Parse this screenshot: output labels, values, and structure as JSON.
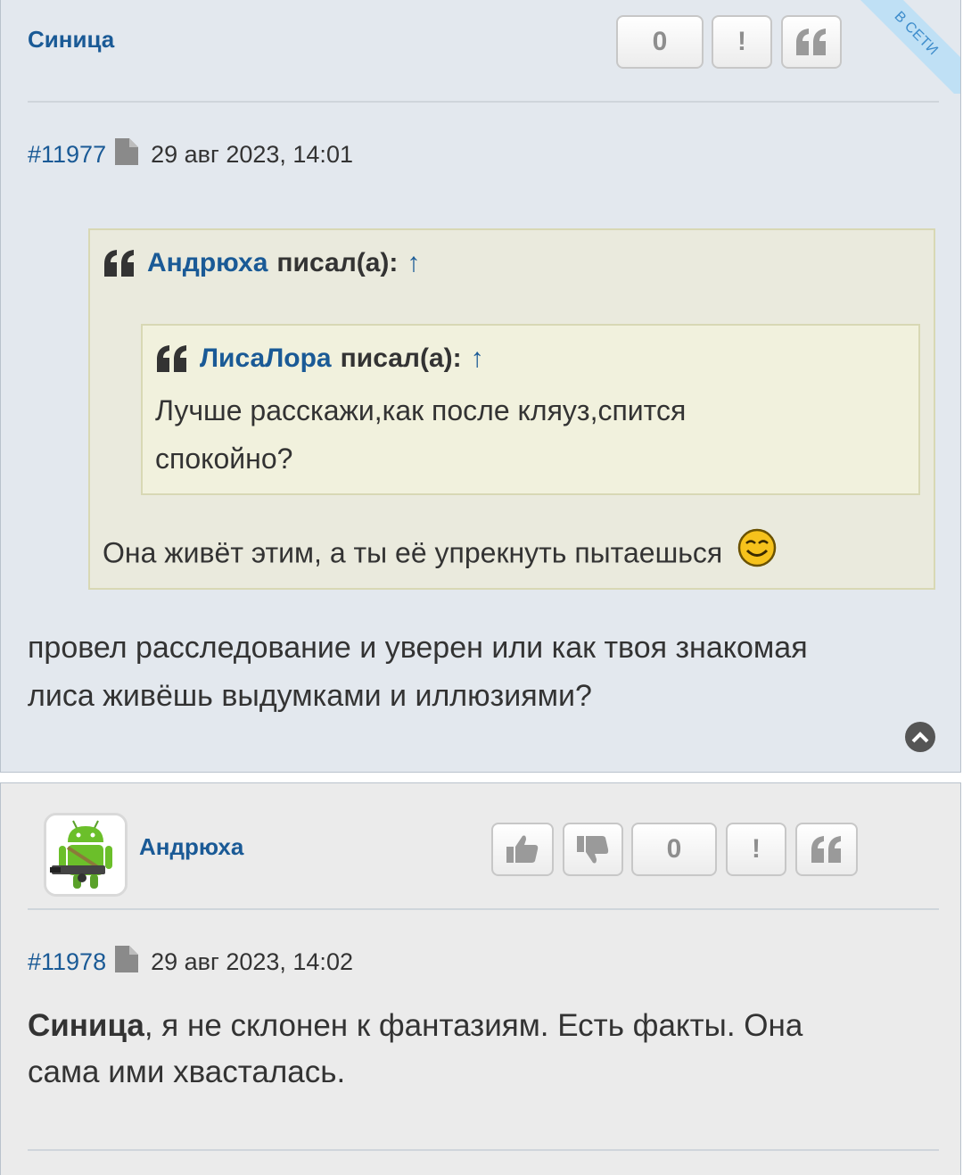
{
  "post1": {
    "author": "Синица",
    "rating": "0",
    "report_label": "!",
    "quote_label": "66",
    "online_ribbon": "В СЕТИ",
    "number": "#11977",
    "date": "29 авг 2023, 14:01",
    "outer_quote": {
      "author": "Андрюха",
      "wrote": "писал(а):",
      "arrow": "↑",
      "text": "Она живёт этим, а ты её упрекнуть пытаешься"
    },
    "inner_quote": {
      "author": "ЛисаЛора",
      "wrote": "писал(а):",
      "arrow": "↑",
      "line1": "Лучше расскажи,как после кляуз,спится",
      "line2": "спокойно?"
    },
    "body_line1": "провел расследование и уверен или как твоя знакомая",
    "body_line2": "лиса живёшь выдумками и иллюзиями?"
  },
  "post2": {
    "author": "Андрюха",
    "rating": "0",
    "report_label": "!",
    "quote_label": "66",
    "number": "#11978",
    "date": "29 авг 2023, 14:02",
    "mention": "Синица",
    "body_line1_rest": ", я не склонен к фантазиям. Есть факты. Она",
    "body_line2": "сама ими хвасталась."
  },
  "colors": {
    "link": "#1a5a96",
    "post1_bg": "#e3e8ee",
    "post2_bg": "#ebebeb",
    "quote_bg": "#eaeadd"
  }
}
